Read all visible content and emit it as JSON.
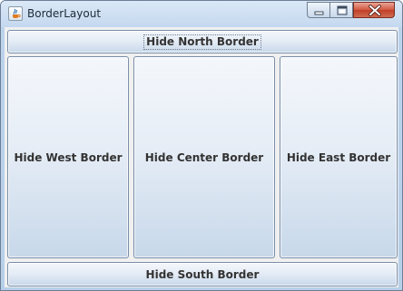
{
  "window": {
    "title": "BorderLayout",
    "app_icon": "java-icon",
    "controls": {
      "minimize": "minimize-icon",
      "maximize": "maximize-icon",
      "close": "close-icon"
    },
    "colors": {
      "frame": "#c4d8ef",
      "close_button": "#c8503a",
      "button_text": "#333333"
    }
  },
  "buttons": {
    "north": "Hide North Border",
    "west": "Hide West Border",
    "center": "Hide Center Border",
    "east": "Hide East Border",
    "south": "Hide South Border"
  }
}
